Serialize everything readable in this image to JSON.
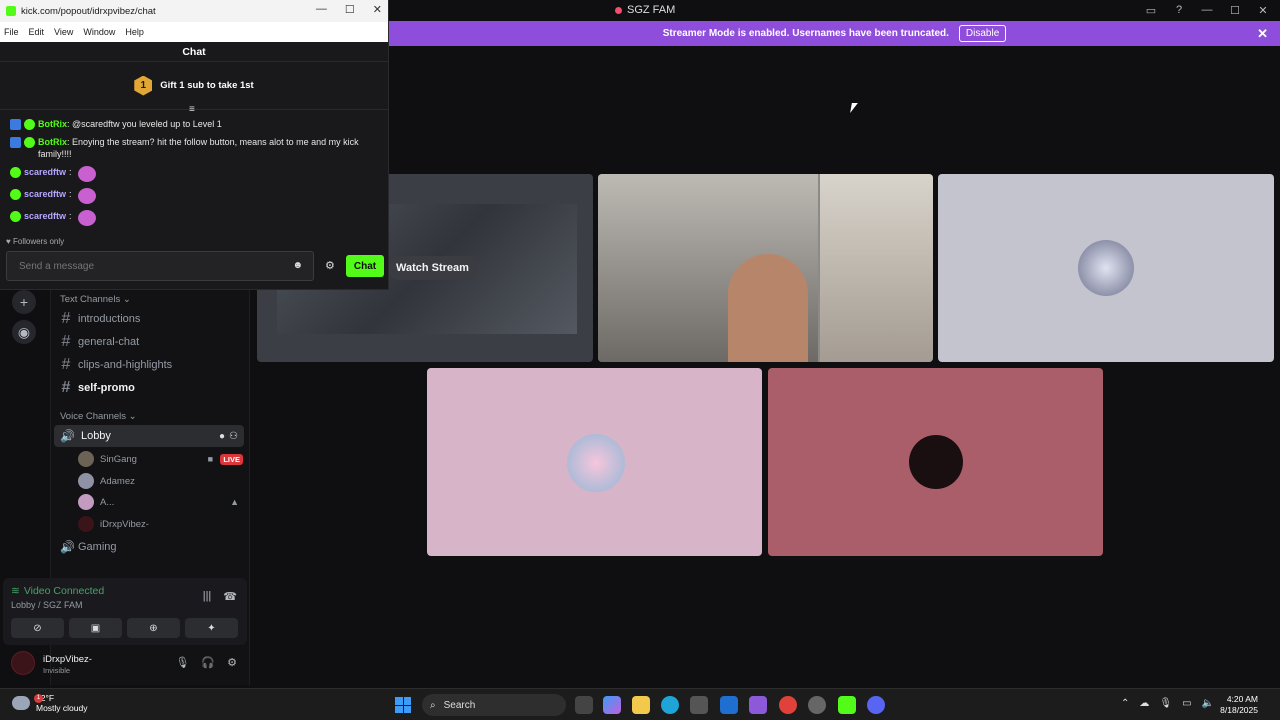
{
  "discord": {
    "window_title": "SGZ FAM",
    "banner_text": "Streamer Mode is enabled. Usernames have been truncated.",
    "banner_button": "Disable",
    "text_channels_header": "Text Channels",
    "voice_channels_header": "Voice Channels",
    "text_channels": [
      "introductions",
      "general-chat",
      "clips-and-highlights",
      "self-promo"
    ],
    "voice_channels": [
      "Lobby",
      "Gaming"
    ],
    "voice_users": [
      {
        "name": "SinGang",
        "badge": "LIVE"
      },
      {
        "name": "Adamez"
      },
      {
        "name": "A..."
      },
      {
        "name": "iDrxpVibez-"
      }
    ],
    "watch_stream": "Watch Stream",
    "voice_status": "Video Connected",
    "voice_location": "Lobby / SGZ FAM",
    "user_name": "iDrxpVibez-",
    "user_status": "Invisible"
  },
  "kick": {
    "url": "kick.com/popout/idrxpvibez/chat",
    "menu": [
      "File",
      "Edit",
      "View",
      "Window",
      "Help"
    ],
    "chat_title": "Chat",
    "gift_badge": "1",
    "gift_text": "Gift 1 sub to take 1st",
    "messages": [
      {
        "user": "BotRix",
        "text": "@scaredftw you leveled up to Level 1"
      },
      {
        "user": "BotRix",
        "text": "Enoying the stream? hit the follow button, means alot to me and my kick family!!!!"
      },
      {
        "user": "scaredftw",
        "text": ""
      },
      {
        "user": "scaredftw",
        "text": ""
      },
      {
        "user": "scaredftw",
        "text": ""
      }
    ],
    "followers_only": "Followers only",
    "input_placeholder": "Send a message",
    "chat_button": "Chat"
  },
  "taskbar": {
    "temp": "62°F",
    "weather": "Mostly cloudy",
    "weather_badge": "1",
    "search_placeholder": "Search",
    "time": "4:20 AM",
    "date": "8/18/2025"
  },
  "colors": {
    "kick_green": "#53fc18",
    "banner_purple": "#8f4ddb",
    "voice_green": "#45a366",
    "live_red": "#da373c"
  }
}
